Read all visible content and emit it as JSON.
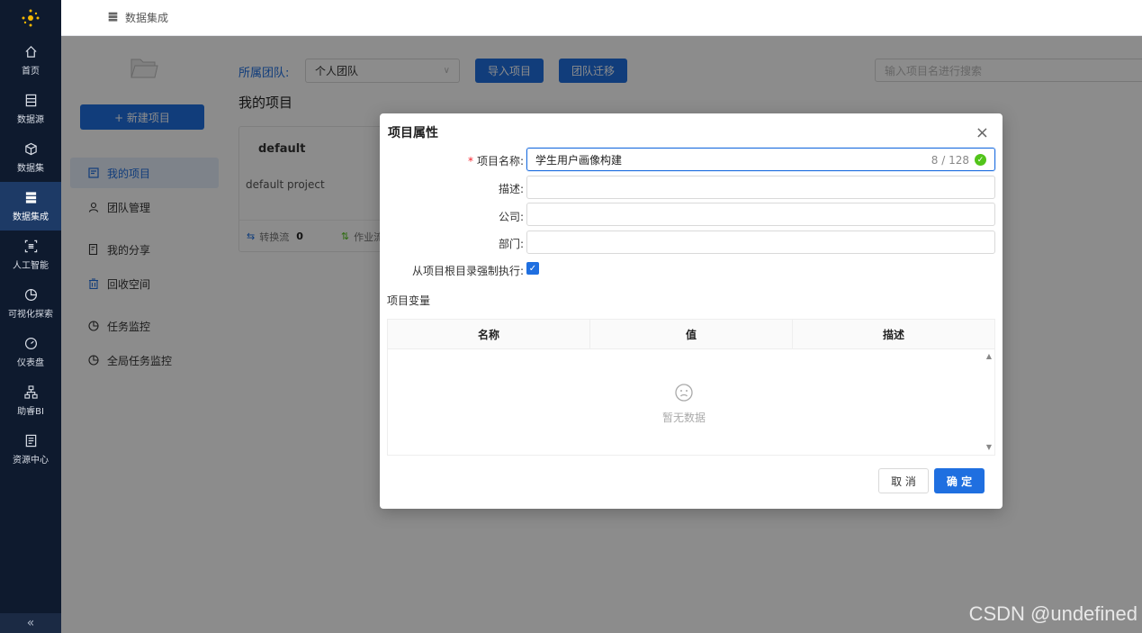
{
  "nav": {
    "items": [
      {
        "label": "首页",
        "icon": "home-icon"
      },
      {
        "label": "数据源",
        "icon": "datasource-icon"
      },
      {
        "label": "数据集",
        "icon": "cube-icon"
      },
      {
        "label": "数据集成",
        "icon": "database-stack-icon",
        "active": true
      },
      {
        "label": "人工智能",
        "icon": "ai-scan-icon"
      },
      {
        "label": "可视化探索",
        "icon": "pie-chart-icon"
      },
      {
        "label": "仪表盘",
        "icon": "gauge-icon"
      },
      {
        "label": "助睿BI",
        "icon": "org-chart-icon"
      },
      {
        "label": "资源中心",
        "icon": "resource-icon"
      }
    ],
    "collapse": "«"
  },
  "header": {
    "title": "数据集成"
  },
  "sidebar": {
    "new_button": "+ 新建项目",
    "items": [
      {
        "label": "我的项目",
        "icon": "project-icon",
        "active": true
      },
      {
        "label": "团队管理",
        "icon": "user-icon"
      },
      {
        "label": "我的分享",
        "icon": "share-doc-icon"
      },
      {
        "label": "回收空间",
        "icon": "trash-icon"
      },
      {
        "label": "任务监控",
        "icon": "pie-chart-icon"
      },
      {
        "label": "全局任务监控",
        "icon": "pie-chart-icon"
      }
    ]
  },
  "main": {
    "team_label": "所属团队:",
    "team_value": "个人团队",
    "import_button": "导入项目",
    "migrate_button": "团队迁移",
    "search_placeholder": "输入项目名进行搜索",
    "section_title": "我的项目",
    "card": {
      "title": "default",
      "description": "default project",
      "flow_label": "转换流",
      "flow_count": "0",
      "job_label": "作业流"
    }
  },
  "dialog": {
    "title": "项目属性",
    "close": "×",
    "fields": {
      "name_label": "项目名称:",
      "name_value": "学生用户画像构建",
      "name_count": "8 / 128",
      "desc_label": "描述:",
      "company_label": "公司:",
      "dept_label": "部门:",
      "force_root_label": "从项目根目录强制执行:"
    },
    "variables_title": "项目变量",
    "table": {
      "columns": [
        "名称",
        "值",
        "描述"
      ],
      "empty_text": "暂无数据"
    },
    "cancel_button": "取 消",
    "ok_button": "确 定"
  },
  "watermark": "CSDN @undefined"
}
